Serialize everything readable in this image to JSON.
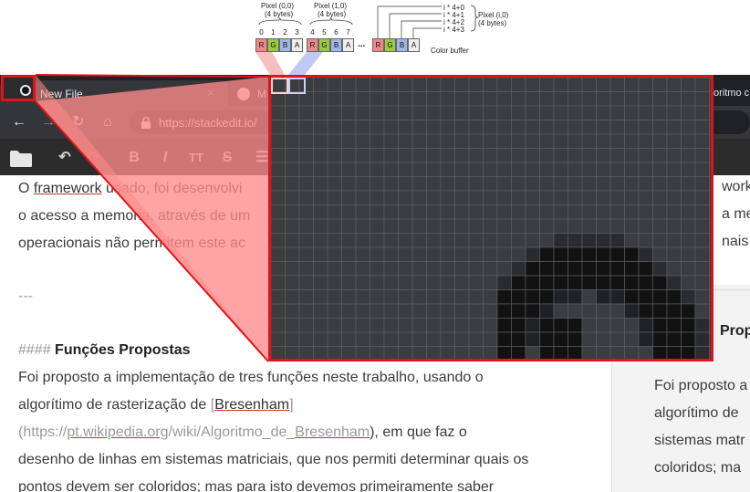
{
  "diagram": {
    "pixel00_label": "Pixel (0,0)",
    "pixel00_bytes": "(4 bytes)",
    "pixel10_label": "Pixel (1,0)",
    "pixel10_bytes": "(4 bytes)",
    "pixeli0_label": "Pixel (i,0)",
    "pixeli0_bytes": "(4 bytes)",
    "indices": [
      "0",
      "1",
      "2",
      "3",
      "4",
      "5",
      "6",
      "7"
    ],
    "channels": [
      "R",
      "G",
      "B",
      "A"
    ],
    "ellipsis": "...",
    "offsets": [
      "i * 4+0",
      "i * 4+1",
      "i * 4+2",
      "i * 4+3"
    ],
    "buffer_label": "Color buffer"
  },
  "browser": {
    "tabs": [
      {
        "label": "New File",
        "close": "×"
      },
      {
        "label": "M"
      },
      {
        "label": "oritmo c"
      }
    ],
    "nav": {
      "back": "←",
      "forward": "→",
      "reload": "↻",
      "home": "⌂"
    },
    "url": "https://stackedit.io/"
  },
  "editor_toolbar": {
    "folder": "folder-icon",
    "undo": "↶",
    "redo": "↷",
    "bold": "B",
    "italic": "I",
    "heading": "TT",
    "strike": "S",
    "list": "☰"
  },
  "document": {
    "line1_pre": "O ",
    "line1_link": "framework",
    "line1_post": " usado, foi desenvolvi",
    "line2": "o acesso a memoria, através de um",
    "line3": "operacionais não permitem este ac",
    "hr": "---",
    "heading_marker": "####",
    "heading_text": " Funções Propostas",
    "para1": "Foi proposto a implementação de tres funções neste trabalho, usando o",
    "para2_pre": "algorítimo de rasterização de ",
    "para2_bracket_open": "[",
    "para2_link": "Bresenham",
    "para2_bracket_close": "]",
    "para3_pre": "(https://",
    "para3_link1": "pt.wikipedia.org",
    "para3_mid": "/wiki/Algoritmo_de_",
    "para3_link2": "Bresenham",
    "para3_post": "), em que faz o",
    "para4": "desenho de linhas em sistemas matriciais, que nos permiti determinar quais os",
    "para5": "pontos devem ser coloridos; mas para isto devemos primeiramente saber"
  },
  "preview": {
    "line1": "work",
    "line2": "a me",
    "line3": "nais r",
    "heading": "Prop",
    "p1": "Foi proposto a",
    "p2": "algorítimo de",
    "p3": "sistemas matr",
    "p4": "coloridos; ma"
  },
  "colors": {
    "overlay_red": "#e0131b",
    "overlay_fill": "#ff8a8a",
    "zoom_bg": "#3a3c3f",
    "icon_dark": "#121212"
  }
}
